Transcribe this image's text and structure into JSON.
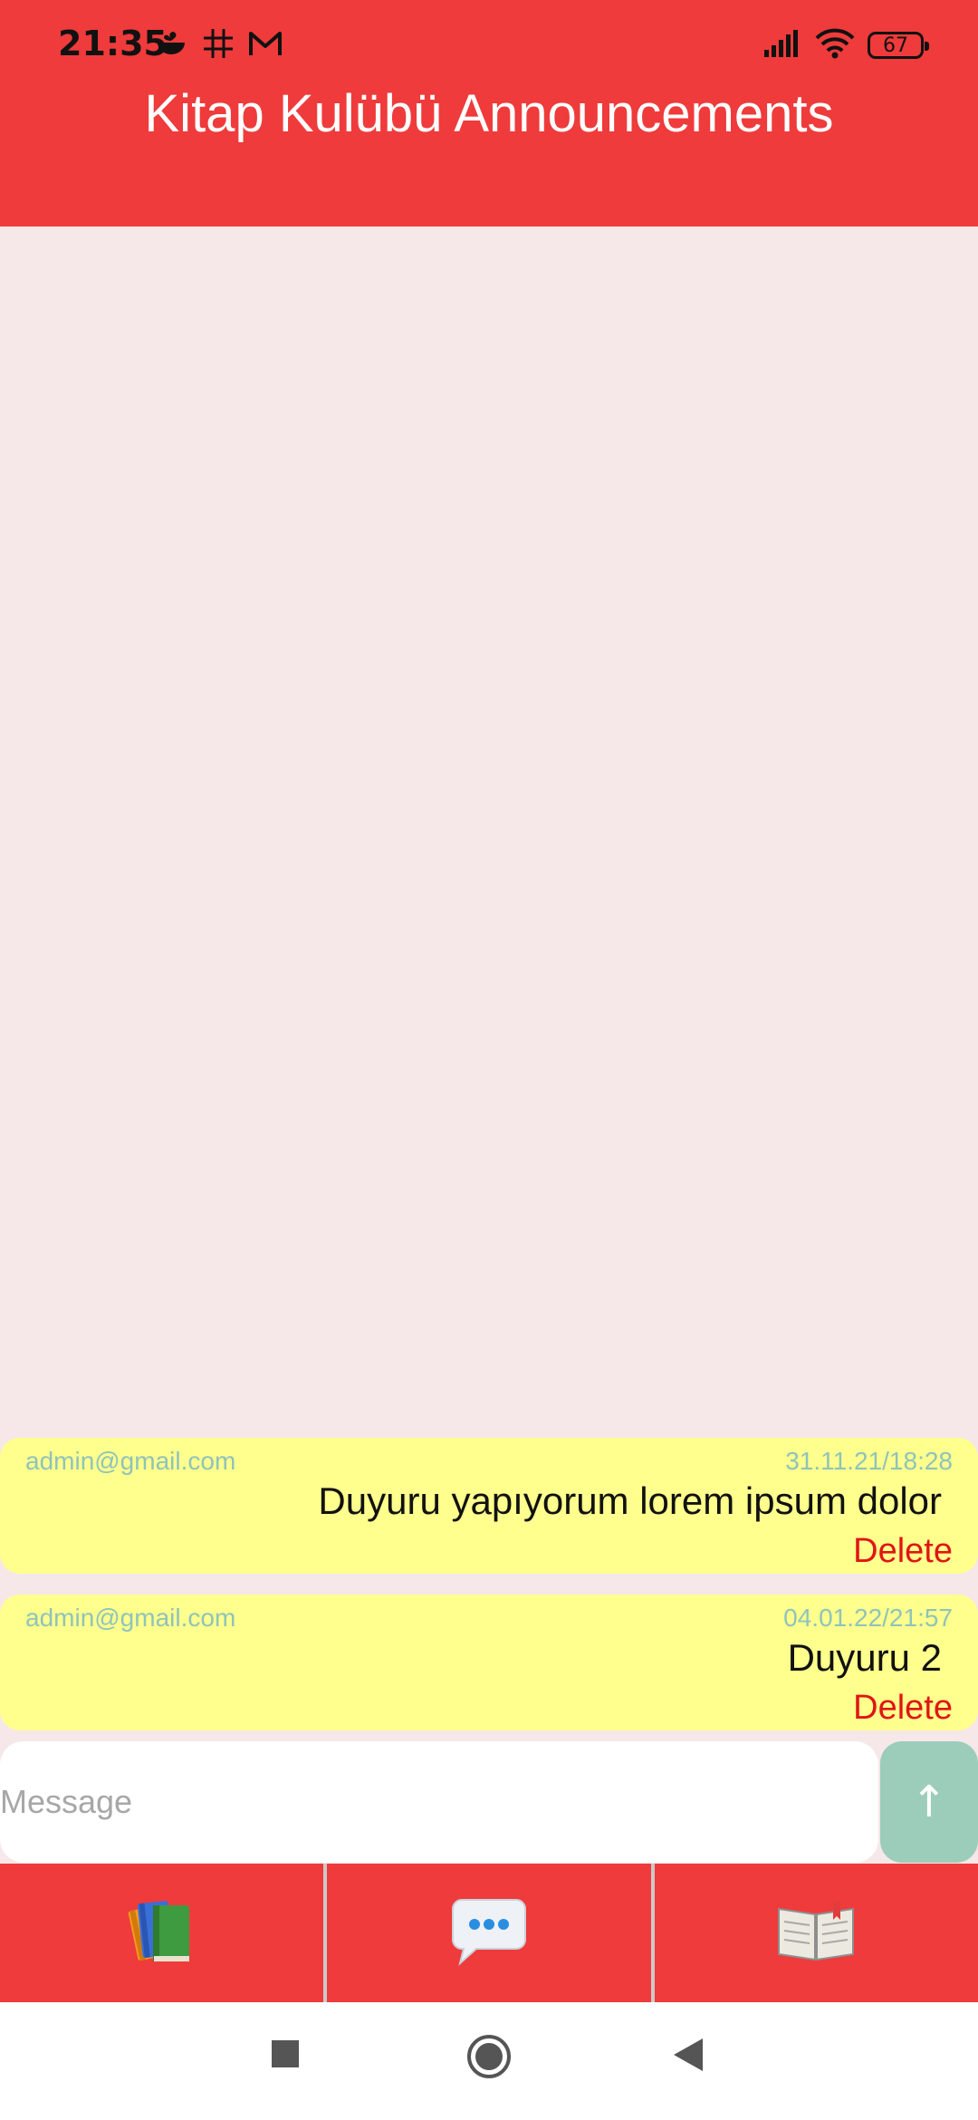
{
  "status_bar": {
    "time": "21:35",
    "battery": "67",
    "icons_left": [
      "leaf-bowl-icon",
      "grid-hash-icon",
      "gmail-icon"
    ],
    "icons_right": [
      "signal-icon",
      "wifi-icon",
      "battery-icon"
    ]
  },
  "header": {
    "title": "Kitap Kulübü Announcements",
    "color": "#ef3b3b"
  },
  "messages": [
    {
      "author": "admin@gmail.com",
      "date": "31.11.21/18:28",
      "text": "Duyuru yapıyorum lorem ipsum dolor",
      "delete_label": "Delete"
    },
    {
      "author": "admin@gmail.com",
      "date": "04.01.22/21:57",
      "text": "Duyuru 2",
      "delete_label": "Delete"
    }
  ],
  "composer": {
    "placeholder": "Message",
    "send_icon": "↑"
  },
  "bottom_nav": [
    {
      "name": "books-icon"
    },
    {
      "name": "chat-bubble-icon"
    },
    {
      "name": "open-book-icon"
    }
  ],
  "system_nav": [
    "recents-square-icon",
    "home-circle-icon",
    "back-triangle-icon"
  ],
  "colors": {
    "primary": "#ef3b3b",
    "background": "#f6e8e8",
    "message_bg": "#ffff8d",
    "meta_text": "#8fc3bb",
    "delete_text": "#e01515",
    "send_button": "#9ccdbb"
  }
}
